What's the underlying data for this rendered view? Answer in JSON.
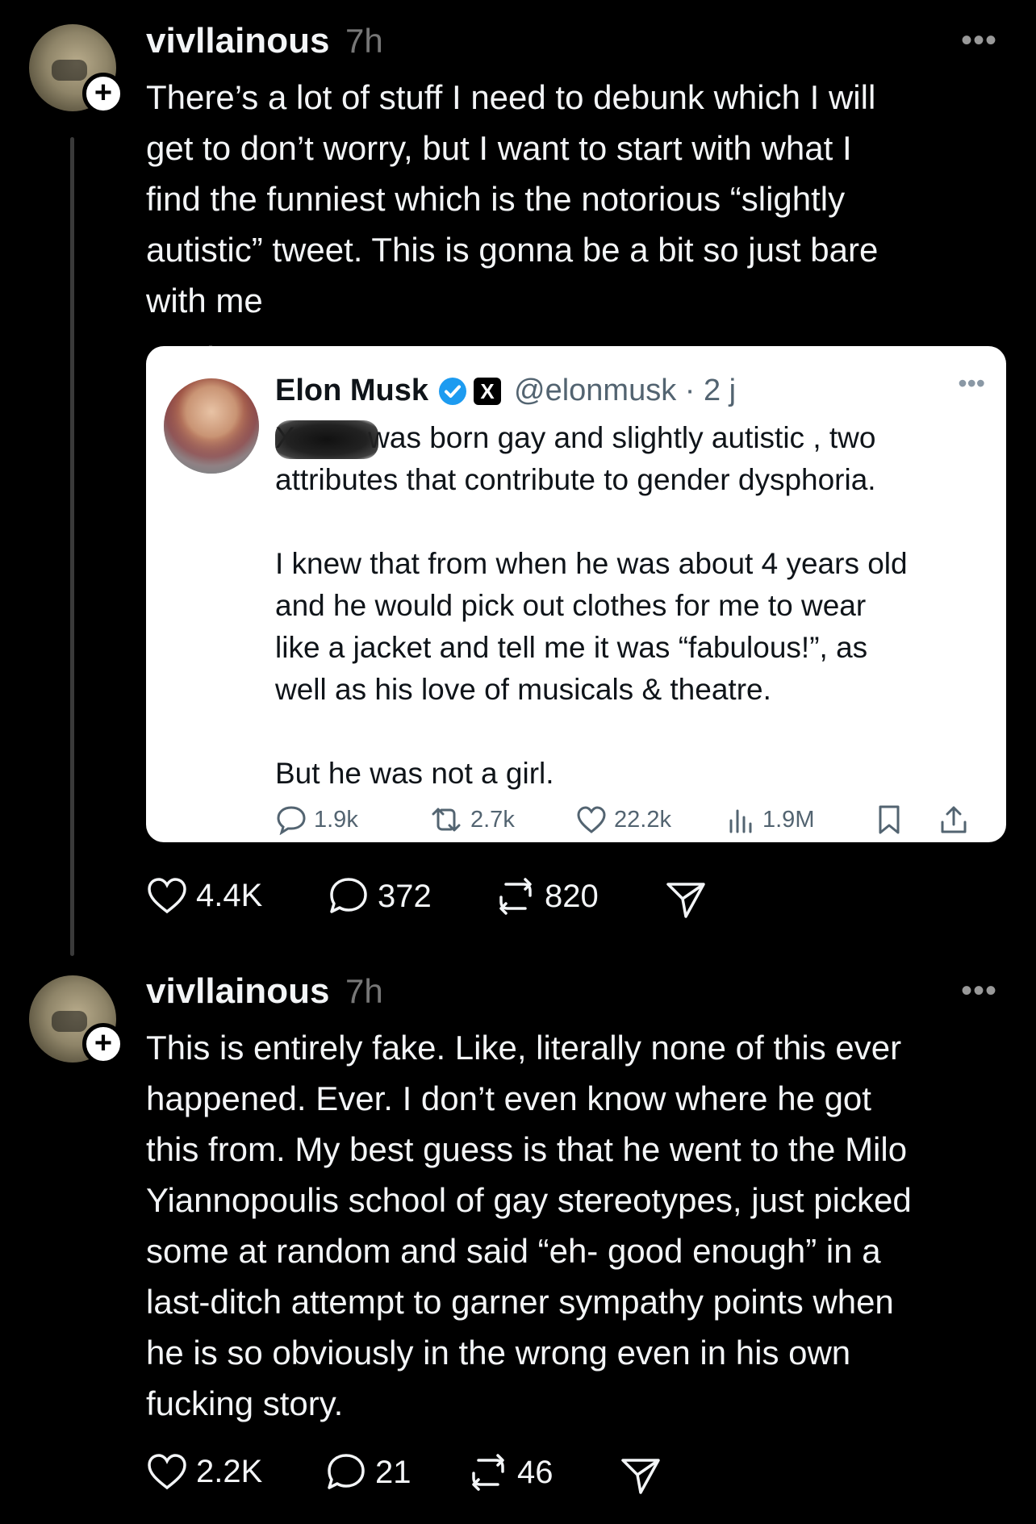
{
  "posts": [
    {
      "username": "vivllainous",
      "time": "7h",
      "more": "•••",
      "text": "There’s a lot of stuff I need to debunk which I will\nget to don’t worry, but I want to start with what I\nfind the funniest which is the notorious “slightly\nautistic” tweet. This is gonna be a bit so just bare\nwith me",
      "quoted": {
        "name": "Elon Musk",
        "x_logo": "X",
        "handle_time": "@elonmusk · 2 j",
        "more": "•••",
        "text": "Xavier was born gay and slightly autistic , two\nattributes that contribute to gender dysphoria.\n\nI knew that from when he was about 4 years old\nand he would pick out clothes for me to wear\nlike a jacket and tell me it was “fabulous!”, as\nwell as his love of musicals & theatre.\n\nBut he was not a girl.",
        "metrics": {
          "replies": "1.9k",
          "reposts": "2.7k",
          "likes": "22.2k",
          "views": "1.9M"
        }
      },
      "likes": "4.4K",
      "replies": "372",
      "reposts": "820"
    },
    {
      "username": "vivllainous",
      "time": "7h",
      "more": "•••",
      "text": "This is entirely fake. Like, literally none of this ever\nhappened. Ever. I don’t even know where he got\nthis from. My best guess is that he went to the Milo\nYiannopoulis school of gay stereotypes, just picked\nsome at random and said “eh- good enough” in a\nlast-ditch attempt to garner sympathy points when\nhe is so obviously in the wrong even in his own\nfucking story.",
      "likes": "2.2K",
      "replies": "21",
      "reposts": "46"
    }
  ]
}
